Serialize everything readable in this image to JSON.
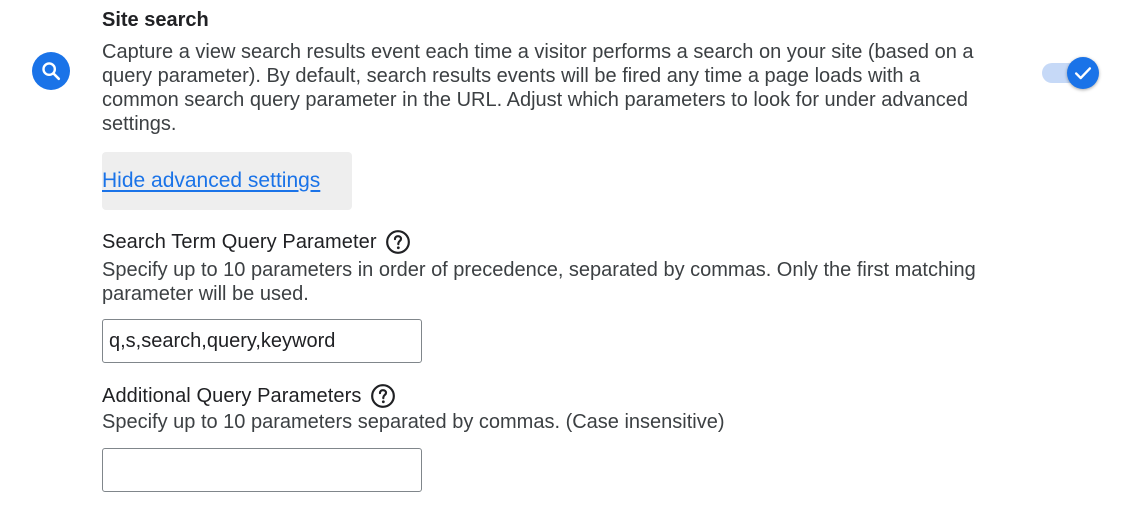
{
  "setting": {
    "title": "Site search",
    "description": "Capture a view search results event each time a visitor performs a search on your site (based on a query parameter). By default, search results events will be fired any time a page loads with a common search query parameter in the URL. Adjust which parameters to look for under advanced settings.",
    "icon": "search-icon",
    "enabled": true
  },
  "advanced": {
    "toggle_label": "Hide advanced settings"
  },
  "search_term": {
    "label": "Search Term Query Parameter",
    "description": "Specify up to 10 parameters in order of precedence, separated by commas. Only the first matching parameter will be used.",
    "value": "q,s,search,query,keyword"
  },
  "additional": {
    "label": "Additional Query Parameters",
    "description": "Specify up to 10 parameters separated by commas. (Case insensitive)",
    "value": ""
  },
  "colors": {
    "accent": "#1a73e8",
    "toggle_track": "#c6d9f7",
    "button_bg": "#eeeeee"
  }
}
